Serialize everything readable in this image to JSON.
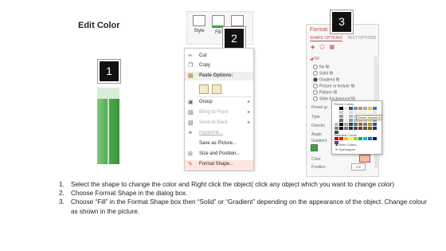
{
  "title": "Edit Color",
  "badges": [
    "1",
    "2",
    "3"
  ],
  "ribbon": {
    "style_label": "Style",
    "fill_label": "Fill"
  },
  "context_menu": {
    "items": [
      {
        "label": "Cut",
        "icon": "scissors-icon",
        "disabled": false
      },
      {
        "label": "Copy",
        "icon": "copy-icon",
        "disabled": false
      },
      {
        "label": "Paste Options:",
        "icon": "paste-icon",
        "header": true
      },
      {
        "label": "Group",
        "icon": "group-icon",
        "submenu": true
      },
      {
        "label": "Bring to Front",
        "icon": "bring-front-icon",
        "submenu": true,
        "disabled": true
      },
      {
        "label": "Send to Back",
        "icon": "send-back-icon",
        "submenu": true,
        "disabled": true
      },
      {
        "label": "Hyperlink...",
        "icon": "link-icon",
        "disabled": true
      },
      {
        "label": "Save as Picture...",
        "icon": "picture-icon"
      },
      {
        "label": "Size and Position...",
        "icon": "size-icon"
      },
      {
        "label": "Format Shape...",
        "icon": "format-shape-icon",
        "selected": true
      }
    ]
  },
  "format_pane": {
    "title": "Format Sha",
    "tabs": [
      "SHAPE OPTIONS",
      "TEXT OPTIONS"
    ],
    "section": "Fill",
    "fill_options": [
      "No fill",
      "Solid fill",
      "Gradient fill",
      "Picture or texture fill",
      "Pattern fill",
      "Slide background fill"
    ],
    "selected_fill": "Gradient fill",
    "labels": [
      "Preset gr",
      "Type",
      "Directio",
      "Angle",
      "Gradient",
      "Color",
      "Position"
    ],
    "position_value": "0%"
  },
  "color_popup": {
    "theme_label": "Theme Colors",
    "tooltip": "Green, Accent 6",
    "standard_label": "Standard Colors",
    "more_colors": "More Colors...",
    "eyedropper": "Eyedropper",
    "theme_top": [
      "#ffffff",
      "#000000",
      "#e7e6e6",
      "#44546a",
      "#5b9bd5",
      "#ed7d31",
      "#a5a5a5",
      "#ffc000",
      "#4472c4",
      "#70ad47"
    ],
    "standard": [
      "#c00000",
      "#ff0000",
      "#ffc000",
      "#ffff00",
      "#92d050",
      "#00b050",
      "#00b0f0",
      "#0070c0",
      "#002060",
      "#7030a0"
    ]
  },
  "instructions": [
    {
      "num": "1.",
      "text": "Select the shape to change the color and Right click the object( click any object which you want to change color)"
    },
    {
      "num": "2.",
      "text": "Choose Format Shape in the dialog box."
    },
    {
      "num": "3.",
      "text": "Choose “Fill” in the Format Shape box then “Solid” or “Gradient” depending on the appearance of the object. Change colour as shown in the picture."
    }
  ]
}
